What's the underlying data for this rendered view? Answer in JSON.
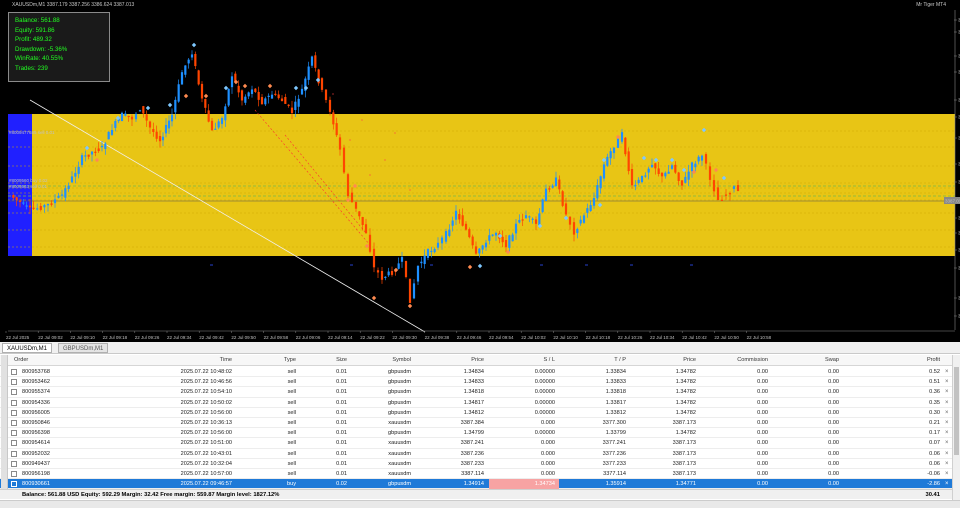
{
  "window": {
    "title": "XAUUSDm,M1  3387.179 3387.256 3386.624 3387.013",
    "ea_name": "Mr Tiger MT4"
  },
  "info_panel": [
    "Balance: 561.88",
    "Equity: 591.86",
    "Profit: 489.32",
    "Drawdown: -5.36%",
    "WinRate: 40.55%",
    "Trades: 239"
  ],
  "price_axis": {
    "min": 3384.6,
    "max": 3390.4,
    "ticks": [
      "3390.385",
      "3390.205",
      "3389.045",
      "3388.815",
      "3388.700",
      "3388.265",
      "3387.710",
      "3387.335",
      "3387.013",
      "3386.785",
      "3386.395",
      "3386.010",
      "3385.725",
      "3385.345",
      "3384.790",
      "3384.600"
    ],
    "current_price": "3387.013"
  },
  "time_axis": [
    "22 Jul 2025",
    "22 Jul 09:02",
    "22 Jul 09:10",
    "22 Jul 09:18",
    "22 Jul 09:26",
    "22 Jul 09:34",
    "22 Jul 09:42",
    "22 Jul 09:50",
    "22 Jul 09:58",
    "22 Jul 09:06",
    "22 Jul 09:14",
    "22 Jul 09:22",
    "22 Jul 09:30",
    "22 Jul 09:38",
    "22 Jul 09:46",
    "22 Jul 09:54",
    "22 Jul 10:02",
    "22 Jul 10:10",
    "22 Jul 10:18",
    "22 Jul 10:26",
    "22 Jul 10:34",
    "22 Jul 10:42",
    "22 Jul 10:50",
    "22 Jul 10:58"
  ],
  "order_labels": [
    "#8009477685 sell 0.01",
    "#8009560 buy 0.02",
    "#8009563 sell 0.01"
  ],
  "colors": {
    "bull": "#1e90ff",
    "bear": "#ff4500",
    "zone": "#e8c515",
    "zone_dark": "#d2a900",
    "left_box": "#2020ff",
    "info_text": "#22ff22",
    "selected_row": "#1f7ad8"
  },
  "tabs": [
    "XAUUSDm,M1",
    "GBPUSDm,M1"
  ],
  "columns": [
    "Order",
    "Time",
    "Type",
    "Size",
    "Symbol",
    "Price",
    "S / L",
    "T / P",
    "Price",
    "Commission",
    "Swap",
    "Profit"
  ],
  "rows": [
    [
      "800953768",
      "2025.07.22 10:48:02",
      "sell",
      "0.01",
      "gbpusdm",
      "1.34834",
      "0.00000",
      "1.33834",
      "1.34782",
      "0.00",
      "0.00",
      "0.52"
    ],
    [
      "800953462",
      "2025.07.22 10:46:56",
      "sell",
      "0.01",
      "gbpusdm",
      "1.34833",
      "0.00000",
      "1.33833",
      "1.34782",
      "0.00",
      "0.00",
      "0.51"
    ],
    [
      "800955374",
      "2025.07.22 10:54:10",
      "sell",
      "0.01",
      "gbpusdm",
      "1.34818",
      "0.00000",
      "1.33818",
      "1.34782",
      "0.00",
      "0.00",
      "0.36"
    ],
    [
      "800954336",
      "2025.07.22 10:50:02",
      "sell",
      "0.01",
      "gbpusdm",
      "1.34817",
      "0.00000",
      "1.33817",
      "1.34782",
      "0.00",
      "0.00",
      "0.35"
    ],
    [
      "800956005",
      "2025.07.22 10:56:00",
      "sell",
      "0.01",
      "gbpusdm",
      "1.34812",
      "0.00000",
      "1.33812",
      "1.34782",
      "0.00",
      "0.00",
      "0.30"
    ],
    [
      "800950846",
      "2025.07.22 10:36:13",
      "sell",
      "0.01",
      "xauusdm",
      "3387.384",
      "0.000",
      "3377.300",
      "3387.173",
      "0.00",
      "0.00",
      "0.21"
    ],
    [
      "800956398",
      "2025.07.22 10:56:00",
      "sell",
      "0.01",
      "gbpusdm",
      "1.34799",
      "0.00000",
      "1.33799",
      "1.34782",
      "0.00",
      "0.00",
      "0.17"
    ],
    [
      "800954614",
      "2025.07.22 10:51:00",
      "sell",
      "0.01",
      "xauusdm",
      "3387.241",
      "0.000",
      "3377.241",
      "3387.173",
      "0.00",
      "0.00",
      "0.07"
    ],
    [
      "800952032",
      "2025.07.22 10:43:01",
      "sell",
      "0.01",
      "xauusdm",
      "3387.236",
      "0.000",
      "3377.236",
      "3387.173",
      "0.00",
      "0.00",
      "0.06"
    ],
    [
      "800949437",
      "2025.07.22 10:32:04",
      "sell",
      "0.01",
      "xauusdm",
      "3387.233",
      "0.000",
      "3377.233",
      "3387.173",
      "0.00",
      "0.00",
      "0.06"
    ],
    [
      "800956198",
      "2025.07.22 10:57:00",
      "sell",
      "0.01",
      "xauusdm",
      "3387.114",
      "0.000",
      "3377.114",
      "3387.173",
      "0.00",
      "0.00",
      "-0.06"
    ],
    [
      "800930661",
      "2025.07.22 09:46:57",
      "buy",
      "0.02",
      "gbpusdm",
      "1.34914",
      "1.34734",
      "1.35914",
      "1.34771",
      "0.00",
      "0.00",
      "-2.86"
    ]
  ],
  "balance_line": "Balance: 561.88 USD  Equity: 592.29  Margin: 32.42  Free margin: 559.87  Margin level: 1827.12%",
  "total_profit": "30.41"
}
